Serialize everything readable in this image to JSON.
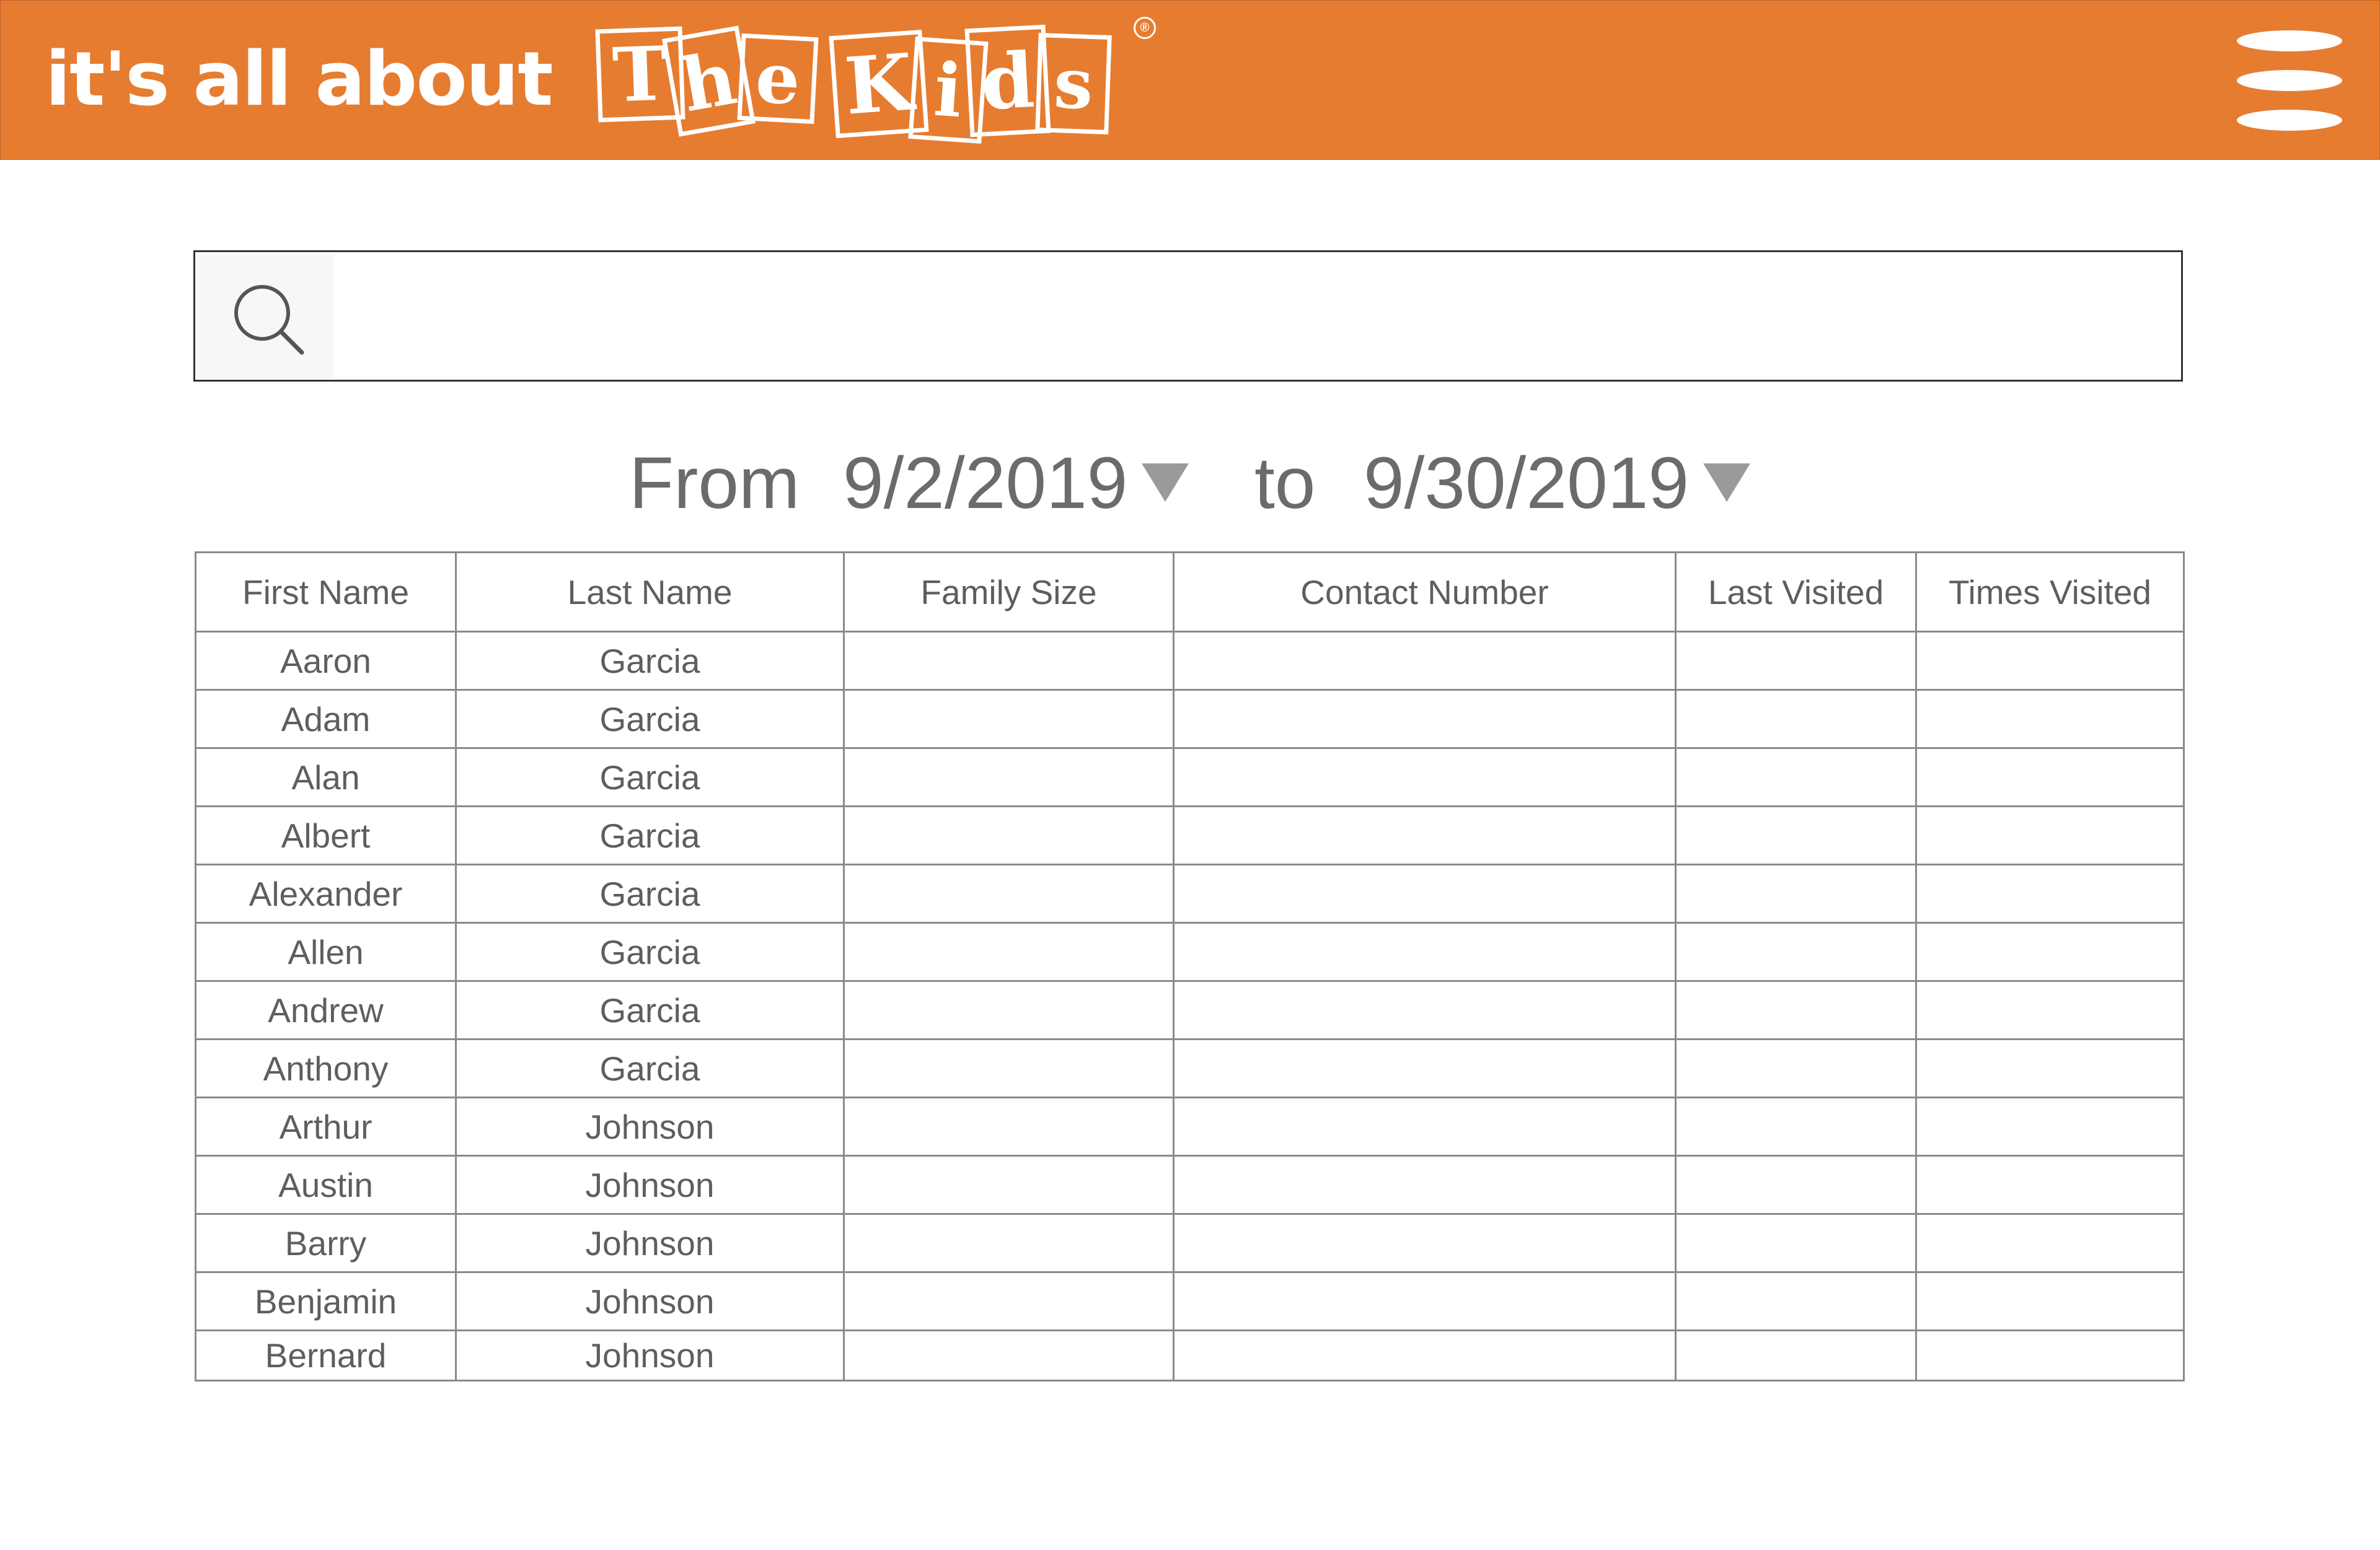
{
  "header": {
    "logo_text": "it's all about",
    "logo_brand": "The Kids",
    "logo_reg": "®",
    "menu_icon": "hamburger-menu-icon",
    "background_color": "#E67C30"
  },
  "search": {
    "icon": "search-icon",
    "value": "",
    "placeholder": ""
  },
  "date_range": {
    "from_label": "From",
    "from_value": "9/2/2019",
    "to_label": "to",
    "to_value": "9/30/2019",
    "dropdown_icon": "triangle-down-icon"
  },
  "table": {
    "columns": [
      "First Name",
      "Last Name",
      "Family Size",
      "Contact Number",
      "Last Visited",
      "Times Visited"
    ],
    "rows": [
      [
        "Aaron",
        "Garcia",
        "",
        "",
        "",
        ""
      ],
      [
        "Adam",
        "Garcia",
        "",
        "",
        "",
        ""
      ],
      [
        "Alan",
        "Garcia",
        "",
        "",
        "",
        ""
      ],
      [
        "Albert",
        "Garcia",
        "",
        "",
        "",
        ""
      ],
      [
        "Alexander",
        "Garcia",
        "",
        "",
        "",
        ""
      ],
      [
        "Allen",
        "Garcia",
        "",
        "",
        "",
        ""
      ],
      [
        "Andrew",
        "Garcia",
        "",
        "",
        "",
        ""
      ],
      [
        "Anthony",
        "Garcia",
        "",
        "",
        "",
        ""
      ],
      [
        "Arthur",
        "Johnson",
        "",
        "",
        "",
        ""
      ],
      [
        "Austin",
        "Johnson",
        "",
        "",
        "",
        ""
      ],
      [
        "Barry",
        "Johnson",
        "",
        "",
        "",
        ""
      ],
      [
        "Benjamin",
        "Johnson",
        "",
        "",
        "",
        ""
      ],
      [
        "Bernard",
        "Johnson",
        "",
        "",
        "",
        ""
      ]
    ]
  }
}
